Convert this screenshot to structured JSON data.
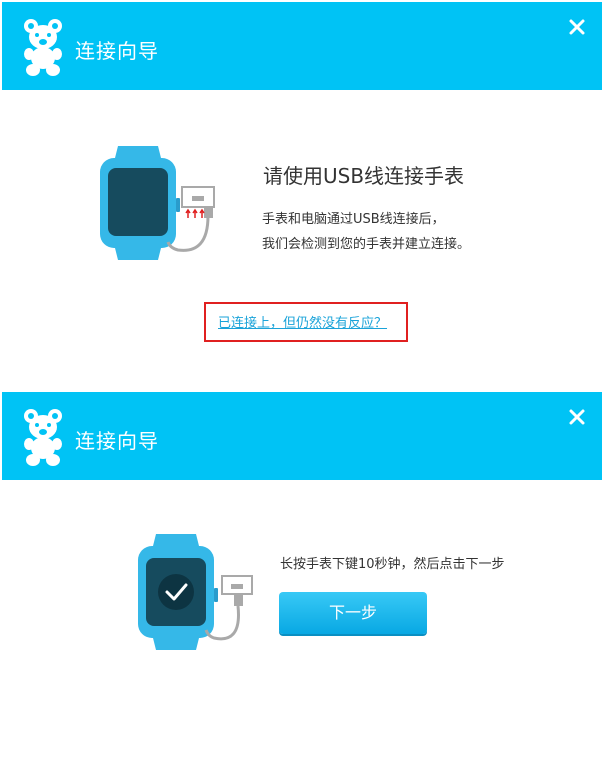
{
  "colors": {
    "header_bg": "#00c3f5",
    "link": "#1aa3d9",
    "highlight_border": "#e02020",
    "button": "#08a8e3",
    "watch_body": "#35b8e8",
    "watch_screen": "#164b5e"
  },
  "dialog1": {
    "header": {
      "title": "连接向导",
      "logo_icon": "teddy-bear-icon",
      "close_icon": "close-icon"
    },
    "headline": "请使用USB线连接手表",
    "description_line1": "手表和电脑通过USB线连接后，",
    "description_line2": "我们会检测到您的手表并建立连接。",
    "help_link": "已连接上，但仍然没有反应？"
  },
  "dialog2": {
    "header": {
      "title": "连接向导",
      "logo_icon": "teddy-bear-icon",
      "close_icon": "close-icon"
    },
    "instruction": "长按手表下键10秒钟，然后点击下一步",
    "next_button": "下一步"
  }
}
